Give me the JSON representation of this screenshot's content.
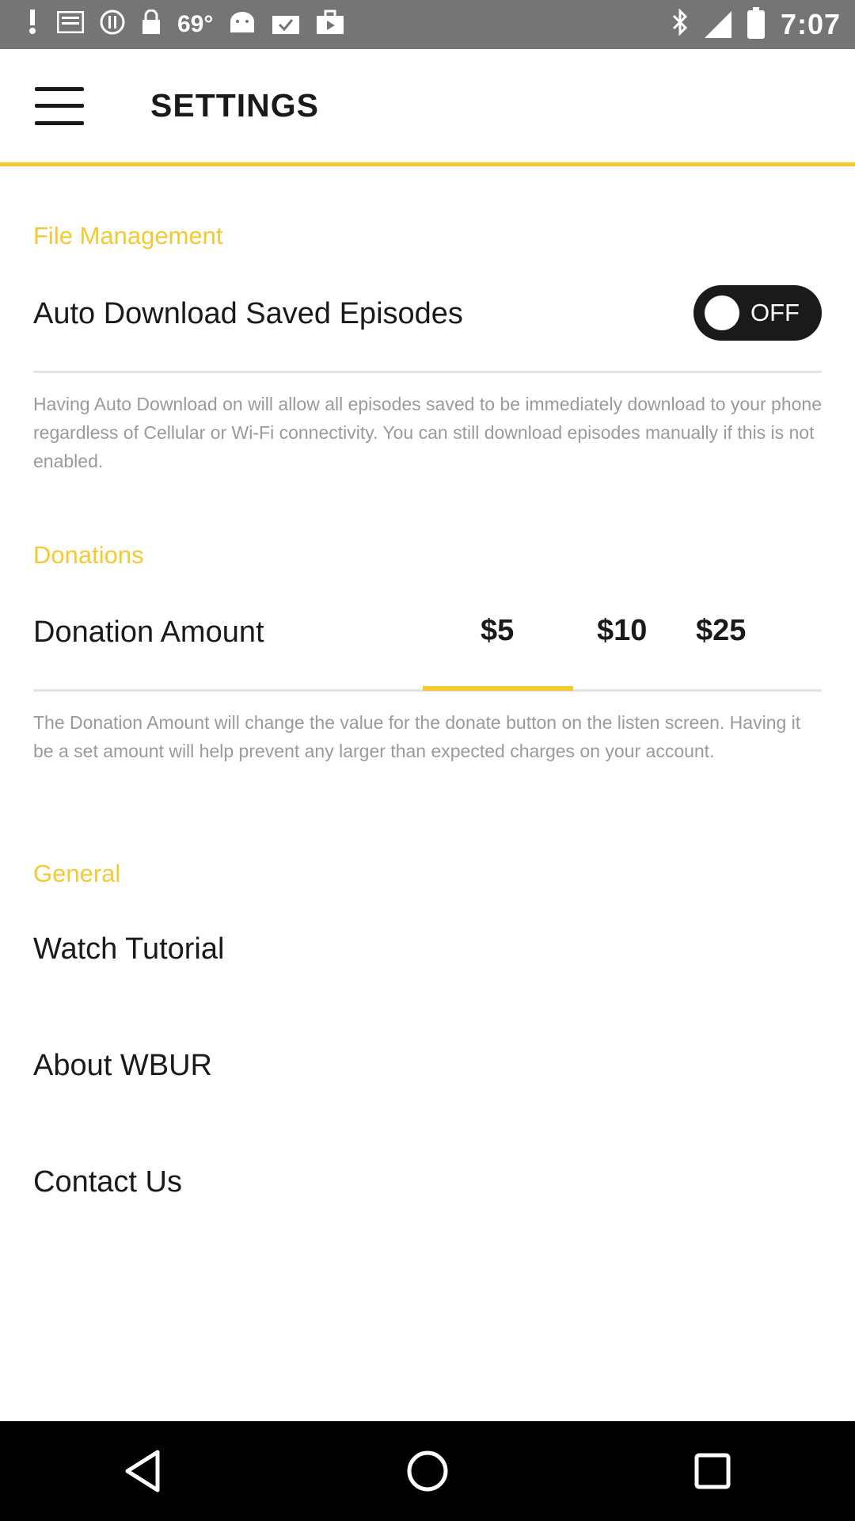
{
  "status_bar": {
    "temperature": "69°",
    "time": "7:07",
    "icons": [
      "notification-icon",
      "mail-icon",
      "do-not-disturb-icon",
      "lock-icon",
      "android-icon",
      "task-icon",
      "briefcase-icon",
      "bluetooth-icon",
      "signal-icon",
      "battery-icon"
    ]
  },
  "header": {
    "title": "SETTINGS",
    "menu_icon": "hamburger-menu-icon"
  },
  "file_management": {
    "section_title": "File Management",
    "auto_download_label": "Auto Download Saved Episodes",
    "toggle_state": "OFF",
    "help_text": "Having Auto Download on will allow all episodes saved to be immediately download to your phone regardless of Cellular or Wi-Fi connectivity. You can still download episodes manually if this is not enabled."
  },
  "donations": {
    "section_title": "Donations",
    "label": "Donation Amount",
    "options": [
      "$5",
      "$10",
      "$25"
    ],
    "selected": "$5",
    "help_text": "The Donation Amount will change the value for the donate button on the listen screen. Having it be a set amount will help prevent any larger than expected charges on your account."
  },
  "general": {
    "section_title": "General",
    "items": [
      "Watch Tutorial",
      "About WBUR",
      "Contact Us"
    ]
  },
  "colors": {
    "accent": "#f5c932",
    "status_bar": "#757575",
    "nav_bar": "#000000"
  }
}
